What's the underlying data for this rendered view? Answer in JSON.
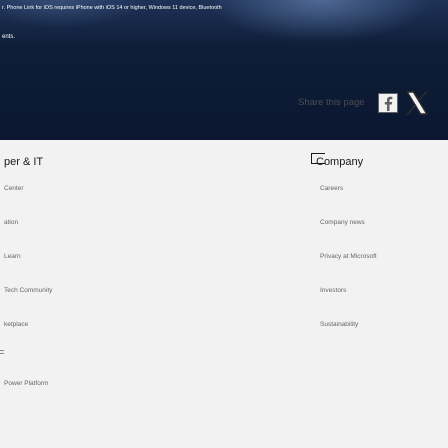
{
  "banner": {
    "disclaimer": "r. Phone Link for iOS requires iPhone with iOS 14 or higher, Windows 11 device, Bluetooth",
    "link_fragment": "ents."
  },
  "share": {
    "label": "Share this page",
    "icons": [
      "facebook-icon",
      "x-icon"
    ]
  },
  "left_column": {
    "heading": "per & IT",
    "links": [
      "Center",
      "ation",
      "Learn",
      "Tech Community",
      "ketplace",
      "Power Platform"
    ]
  },
  "right_column": {
    "heading": "Company",
    "links": [
      "Careers",
      "Company news",
      "Privacy at Microsoft",
      "Investors",
      "Sustainability"
    ]
  }
}
